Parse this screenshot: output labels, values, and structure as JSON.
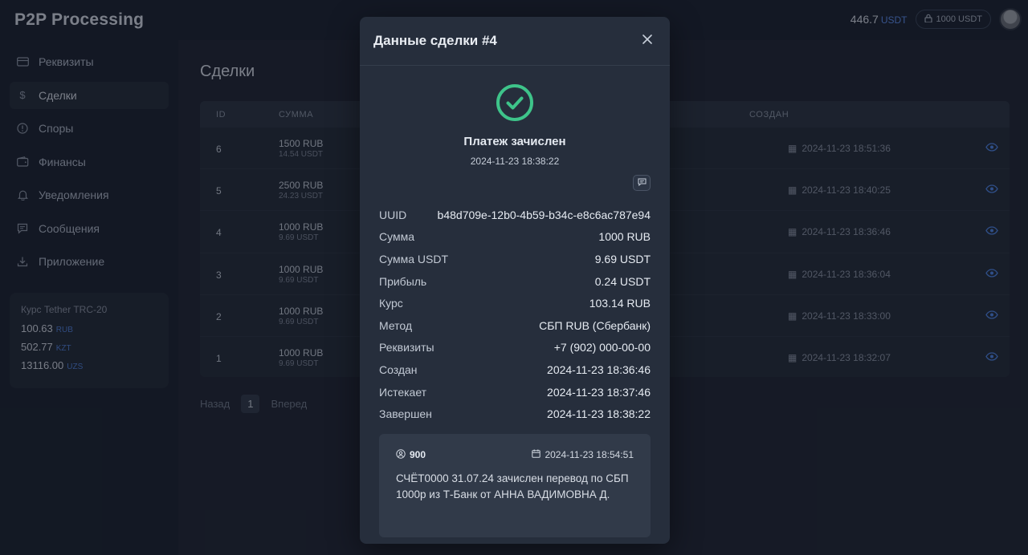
{
  "app": {
    "title": "P2P Processing"
  },
  "header": {
    "balance_value": "446.7",
    "balance_currency": "USDT",
    "deposit_label": "1000 USDT"
  },
  "sidebar": {
    "items": [
      {
        "label": "Реквизиты",
        "icon": "card-icon",
        "active": false
      },
      {
        "label": "Сделки",
        "icon": "dollar-icon",
        "active": true
      },
      {
        "label": "Споры",
        "icon": "alert-icon",
        "active": false
      },
      {
        "label": "Финансы",
        "icon": "wallet-icon",
        "active": false
      },
      {
        "label": "Уведомления",
        "icon": "bell-icon",
        "active": false
      },
      {
        "label": "Сообщения",
        "icon": "chat-icon",
        "active": false
      },
      {
        "label": "Приложение",
        "icon": "download-icon",
        "active": false
      }
    ],
    "rates": {
      "title": "Курс Tether TRC-20",
      "rows": [
        {
          "value": "100.63",
          "currency": "RUB"
        },
        {
          "value": "502.77",
          "currency": "KZT"
        },
        {
          "value": "13116.00",
          "currency": "UZS"
        }
      ]
    }
  },
  "main": {
    "title": "Сделки",
    "columns": {
      "id": "ID",
      "amount": "СУММА",
      "created": "СОЗДАН"
    },
    "rows": [
      {
        "id": "6",
        "amount": "1500 RUB",
        "usdt": "14.54 USDT",
        "created": "2024-11-23 18:51:36"
      },
      {
        "id": "5",
        "amount": "2500 RUB",
        "usdt": "24.23 USDT",
        "created": "2024-11-23 18:40:25"
      },
      {
        "id": "4",
        "amount": "1000 RUB",
        "usdt": "9.69 USDT",
        "created": "2024-11-23 18:36:46"
      },
      {
        "id": "3",
        "amount": "1000 RUB",
        "usdt": "9.69 USDT",
        "created": "2024-11-23 18:36:04"
      },
      {
        "id": "2",
        "amount": "1000 RUB",
        "usdt": "9.69 USDT",
        "created": "2024-11-23 18:33:00"
      },
      {
        "id": "1",
        "amount": "1000 RUB",
        "usdt": "9.69 USDT",
        "created": "2024-11-23 18:32:07"
      }
    ],
    "pager": {
      "prev": "Назад",
      "page": "1",
      "next": "Вперед"
    }
  },
  "modal": {
    "title": "Данные сделки #4",
    "status": "Платеж зачислен",
    "status_time": "2024-11-23 18:38:22",
    "status_color": "#3ec48a",
    "details": [
      {
        "key": "UUID",
        "value": "b48d709e-12b0-4b59-b34c-e8c6ac787e94"
      },
      {
        "key": "Сумма",
        "value": "1000 RUB"
      },
      {
        "key": "Сумма USDT",
        "value": "9.69 USDT"
      },
      {
        "key": "Прибыль",
        "value": "0.24 USDT"
      },
      {
        "key": "Курс",
        "value": "103.14 RUB"
      },
      {
        "key": "Метод",
        "value": "СБП RUB (Сбербанк)"
      },
      {
        "key": "Реквизиты",
        "value": "+7 (902) 000-00-00"
      },
      {
        "key": "Создан",
        "value": "2024-11-23 18:36:46"
      },
      {
        "key": "Истекает",
        "value": "2024-11-23 18:37:46"
      },
      {
        "key": "Завершен",
        "value": "2024-11-23 18:38:22"
      }
    ],
    "note": {
      "user": "900",
      "time": "2024-11-23 18:54:51",
      "text": "СЧЁТ0000 31.07.24 зачислен перевод по СБП 1000р из Т-Банк от АННА ВАДИМОВНА Д."
    }
  }
}
